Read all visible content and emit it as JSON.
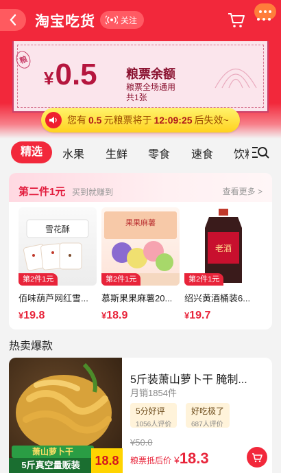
{
  "header": {
    "title": "淘宝吃货",
    "follow_label": "关注"
  },
  "coupon": {
    "currency": "¥",
    "amount": "0.5",
    "title": "粮票余额",
    "line1": "粮票全场通用",
    "line2": "共1张",
    "stamp": "粮"
  },
  "notice": {
    "prefix": "您有",
    "amount": "0.5",
    "middle": "元粮票将于",
    "time": "12:09:25",
    "suffix": "后失效~"
  },
  "tabs": [
    {
      "label": "精选"
    },
    {
      "label": "水果"
    },
    {
      "label": "生鲜"
    },
    {
      "label": "零食"
    },
    {
      "label": "速食"
    },
    {
      "label": "饮料"
    }
  ],
  "section1": {
    "title": "第二件1元",
    "subtitle": "买到就赚到",
    "more": "查看更多 >",
    "products": [
      {
        "name": "佰味葫芦网红雪...",
        "badge": "第2件1元",
        "currency": "¥",
        "price": "19.8",
        "img_text": "雪花酥"
      },
      {
        "name": "慕斯果果麻薯20...",
        "badge": "第2件1元",
        "currency": "¥",
        "price": "18.9",
        "img_text": "果果麻薯"
      },
      {
        "name": "绍兴黄酒桶装6...",
        "badge": "第2件1元",
        "currency": "¥",
        "price": "19.7",
        "img_text": "老酒"
      }
    ]
  },
  "hot": {
    "title": "热卖爆款",
    "name": "5斤装萧山萝卜干 腌制...",
    "sales": "月销1854件",
    "reviews": [
      {
        "tag": "5分好评",
        "count": "1056人评价"
      },
      {
        "tag": "好吃极了",
        "count": "687人评价"
      }
    ],
    "old_price": "¥50.0",
    "price_label": "粮票抵后价",
    "currency": "¥",
    "price": "18.3",
    "img_label1": "萧山萝卜干",
    "img_label2": "5斤真空量贩装",
    "img_price": "18.8"
  },
  "colors": {
    "brand_red": "#f2283b",
    "notice_yellow": "#ffd21f"
  }
}
